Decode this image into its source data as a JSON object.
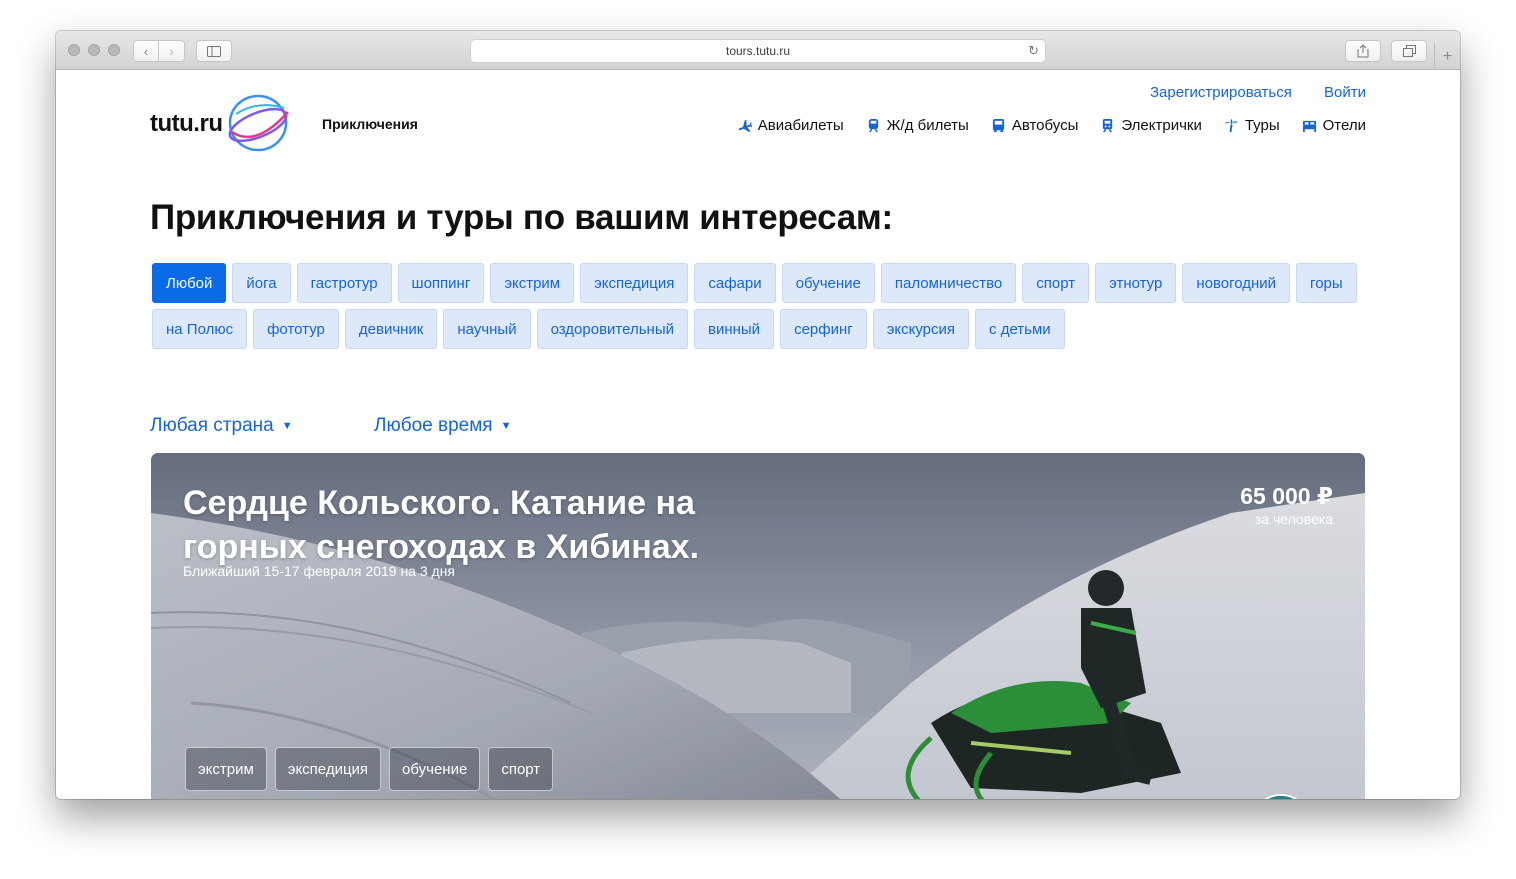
{
  "browser": {
    "url": "tours.tutu.ru",
    "icons": [
      "back-icon",
      "forward-icon",
      "sidebar-icon",
      "reload-icon",
      "share-icon",
      "tabs-icon",
      "new-tab-icon"
    ]
  },
  "header": {
    "logo_text": "tutu.ru",
    "section_name": "Приключения",
    "register_label": "Зарегистрироваться",
    "login_label": "Войти",
    "nav": [
      {
        "label": "Авиабилеты",
        "icon": "plane-icon"
      },
      {
        "label": "Ж/д билеты",
        "icon": "train-icon"
      },
      {
        "label": "Автобусы",
        "icon": "bus-icon"
      },
      {
        "label": "Электрички",
        "icon": "suburban-train-icon"
      },
      {
        "label": "Туры",
        "icon": "palm-icon"
      },
      {
        "label": "Отели",
        "icon": "bed-icon"
      }
    ]
  },
  "main": {
    "headline": "Приключения и туры по вашим интересам:",
    "categories": [
      "Любой",
      "йога",
      "гастротур",
      "шоппинг",
      "экстрим",
      "экспедиция",
      "сафари",
      "обучение",
      "паломничество",
      "спорт",
      "этнотур",
      "новогодний",
      "горы",
      "на Полюс",
      "фототур",
      "девичник",
      "научный",
      "оздоровительный",
      "винный",
      "серфинг",
      "экскурсия",
      "с детьми"
    ],
    "active_category": "Любой",
    "country_filter": "Любая страна",
    "time_filter": "Любое время",
    "accent_color": "#0b6be6"
  },
  "tour": {
    "title": "Сердце Кольского. Катание на горных снегоходах в Хибинах.",
    "date": "Ближайший 15-17 февраля 2019 на 3 дня",
    "price": "65 000 ₽",
    "price_note": "за человека",
    "tags": [
      "экстрим",
      "экспедиция",
      "обучение",
      "спорт"
    ]
  }
}
